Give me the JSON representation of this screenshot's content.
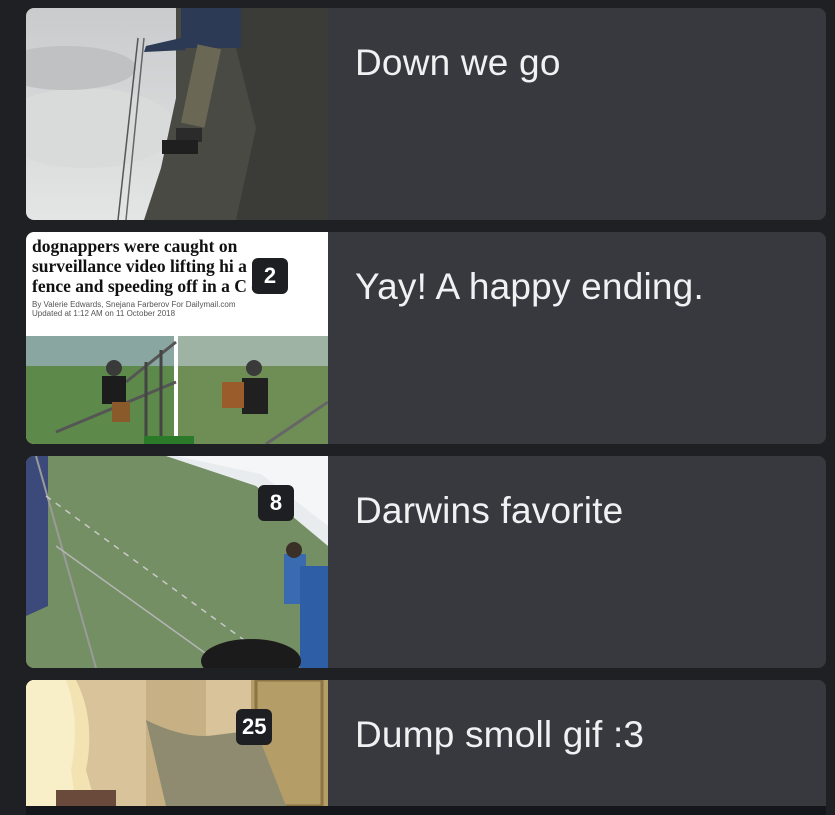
{
  "feed": {
    "posts": [
      {
        "title": "Down we go",
        "count": ""
      },
      {
        "title": "Yay! A happy ending.",
        "count": "2",
        "thumbnail_headline": "dognappers were caught on\nsurveillance video lifting hi      a\nfence and speeding off in a C      e",
        "thumbnail_byline": "By Valerie Edwards, Snejana Farberov For Dailymail.com",
        "thumbnail_updated": "Updated at 1:12 AM on 11 October 2018"
      },
      {
        "title": "Darwins favorite",
        "count": "8"
      },
      {
        "title": "Dump smoll gif :3",
        "count": "25"
      }
    ]
  },
  "colors": {
    "background": "#1f2024",
    "card": "#37393f",
    "badge": "#1e1f22",
    "text": "#f1f1f3"
  }
}
